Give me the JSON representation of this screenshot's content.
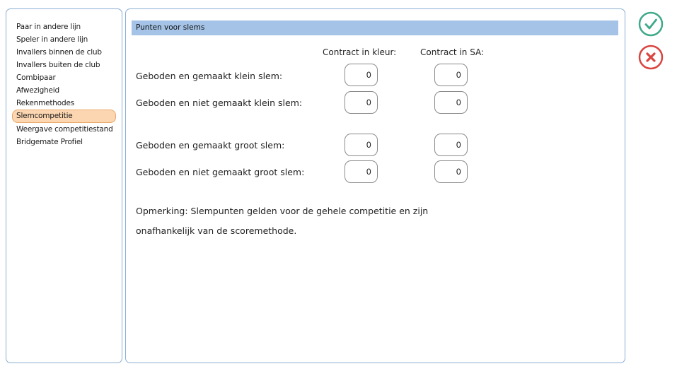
{
  "sidebar": {
    "items": [
      {
        "label": "Paar in andere lijn"
      },
      {
        "label": "Speler in andere lijn"
      },
      {
        "label": "Invallers binnen de club"
      },
      {
        "label": "Invallers buiten de club"
      },
      {
        "label": "Combipaar"
      },
      {
        "label": "Afwezigheid"
      },
      {
        "label": "Rekenmethodes"
      },
      {
        "label": "Slemcompetitie"
      },
      {
        "label": "Weergave competitiestand"
      },
      {
        "label": "Bridgemate Profiel"
      }
    ],
    "selected_index": 7
  },
  "section": {
    "title": "Punten voor slems"
  },
  "columns": {
    "color": "Contract in kleur:",
    "sa": "Contract in SA:"
  },
  "rows": [
    {
      "label": "Geboden en gemaakt klein slem:",
      "color_value": "0",
      "sa_value": "0"
    },
    {
      "label": "Geboden en niet gemaakt klein slem:",
      "color_value": "0",
      "sa_value": "0"
    },
    {
      "label": "Geboden en gemaakt groot slem:",
      "color_value": "0",
      "sa_value": "0"
    },
    {
      "label": "Geboden en niet gemaakt groot slem:",
      "color_value": "0",
      "sa_value": "0"
    }
  ],
  "note": {
    "line1": "Opmerking: Slempunten gelden voor de gehele competitie en zijn",
    "line2": "onafhankelijk van de scoremethode."
  },
  "actions": {
    "confirm_icon": "checkmark-icon",
    "cancel_icon": "x-icon",
    "confirm_color": "#3fa98a",
    "cancel_color": "#d9453f"
  }
}
